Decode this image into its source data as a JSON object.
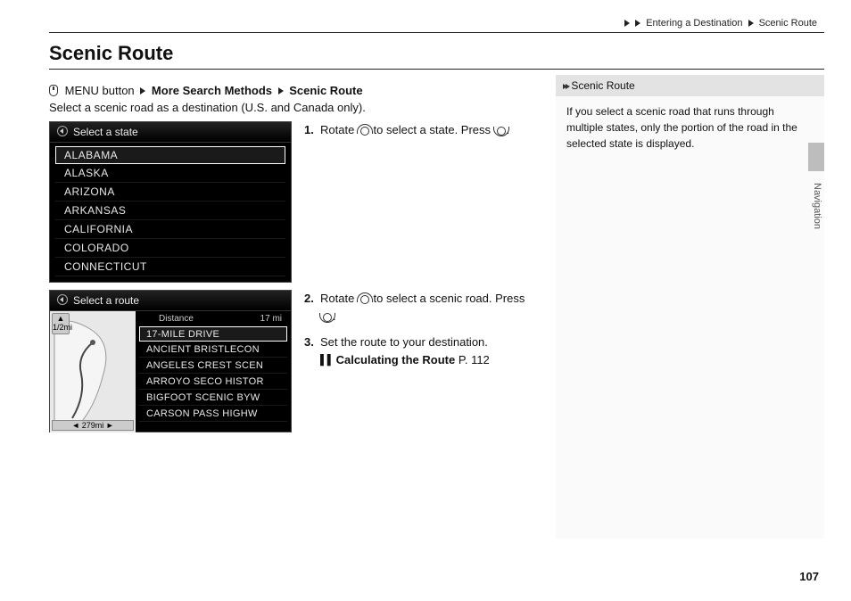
{
  "breadcrumb": {
    "a": "Entering a Destination",
    "b": "Scenic Route"
  },
  "title": "Scenic Route",
  "path": {
    "menu": "MENU button",
    "s1": "More Search Methods",
    "s2": "Scenic Route"
  },
  "description": "Select a scenic road as a destination (U.S. and Canada only).",
  "screen1": {
    "header": "Select a state",
    "items": [
      "ALABAMA",
      "ALASKA",
      "ARIZONA",
      "ARKANSAS",
      "CALIFORNIA",
      "COLORADO",
      "CONNECTICUT"
    ]
  },
  "screen2": {
    "header": "Select a route",
    "distance_label": "Distance",
    "distance_value": "17 mi",
    "north": "N",
    "half": "1/2mi",
    "scale": "279mi",
    "items": [
      "17-MILE DRIVE",
      "ANCIENT BRISTLECON",
      "ANGELES CREST SCEN",
      "ARROYO SECO HISTOR",
      "BIGFOOT SCENIC BYW",
      "CARSON PASS HIGHW"
    ]
  },
  "steps": {
    "s1a": "Rotate ",
    "s1b": " to select a state. Press ",
    "s1c": ".",
    "s2a": "Rotate ",
    "s2b": " to select a scenic road. Press ",
    "s2c": ".",
    "s3a": "Set the route to your destination.",
    "xref_label": "Calculating the Route",
    "xref_page": "P. 112",
    "n1": "1.",
    "n2": "2.",
    "n3": "3."
  },
  "sidebar": {
    "head": "Scenic Route",
    "body": "If you select a scenic road that runs through multiple states, only the portion of the road in the selected state is displayed."
  },
  "section": "Navigation",
  "page_number": "107"
}
